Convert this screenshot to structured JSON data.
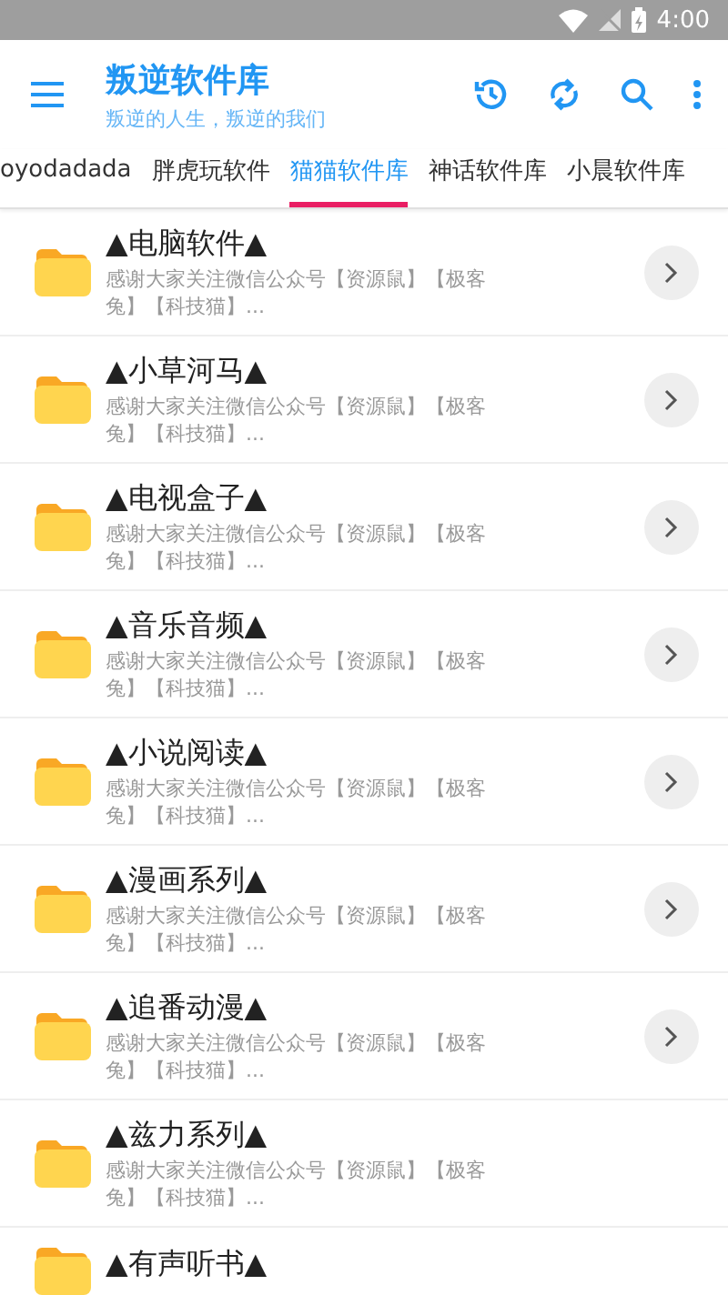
{
  "status_bar": {
    "time": "4:00"
  },
  "toolbar": {
    "title": "叛逆软件库",
    "subtitle": "叛逆的人生，叛逆的我们"
  },
  "tabs": [
    {
      "label": "oyodadada",
      "selected": false
    },
    {
      "label": "胖虎玩软件",
      "selected": false
    },
    {
      "label": "猫猫软件库",
      "selected": true
    },
    {
      "label": "神话软件库",
      "selected": false
    },
    {
      "label": "小晨软件库",
      "selected": false
    }
  ],
  "items": [
    {
      "title": "▲电脑软件▲",
      "description": "感谢大家关注微信公众号【资源鼠】【极客兔】【科技猫】...",
      "arrow": true
    },
    {
      "title": "▲小草河马▲",
      "description": "感谢大家关注微信公众号【资源鼠】【极客兔】【科技猫】...",
      "arrow": true
    },
    {
      "title": "▲电视盒子▲",
      "description": "感谢大家关注微信公众号【资源鼠】【极客兔】【科技猫】...",
      "arrow": true
    },
    {
      "title": "▲音乐音频▲",
      "description": "感谢大家关注微信公众号【资源鼠】【极客兔】【科技猫】...",
      "arrow": true
    },
    {
      "title": "▲小说阅读▲",
      "description": "感谢大家关注微信公众号【资源鼠】【极客兔】【科技猫】...",
      "arrow": true
    },
    {
      "title": "▲漫画系列▲",
      "description": "感谢大家关注微信公众号【资源鼠】【极客兔】【科技猫】...",
      "arrow": true
    },
    {
      "title": "▲追番动漫▲",
      "description": "感谢大家关注微信公众号【资源鼠】【极客兔】【科技猫】...",
      "arrow": true
    },
    {
      "title": "▲兹力系列▲",
      "description": "感谢大家关注微信公众号【资源鼠】【极客兔】【科技猫】...",
      "arrow": false
    },
    {
      "title": "▲有声听书▲",
      "arrow": false
    }
  ]
}
